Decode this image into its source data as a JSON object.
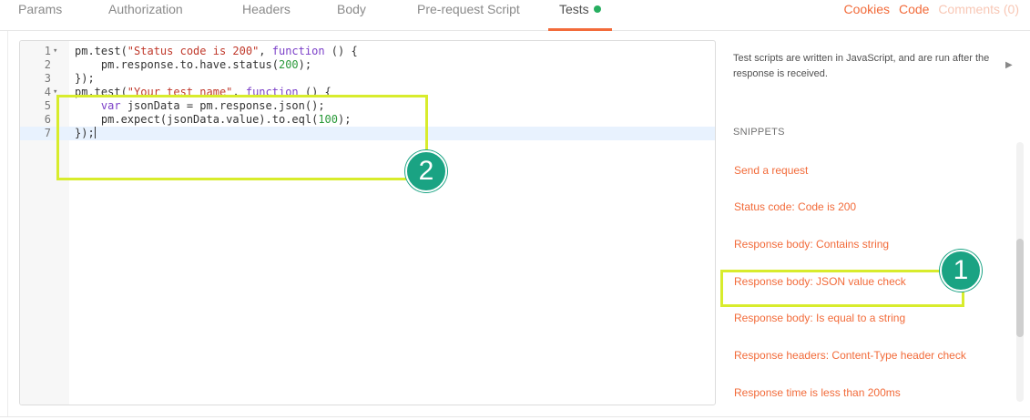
{
  "tabs": [
    "Params",
    "Authorization",
    "Headers",
    "Body",
    "Pre-request Script",
    "Tests"
  ],
  "active_tab": "Tests",
  "links": {
    "cookies": "Cookies",
    "code": "Code",
    "comments": "Comments (0)"
  },
  "editor": {
    "line_numbers": [
      "1",
      "2",
      "3",
      "4",
      "5",
      "6",
      "7"
    ],
    "lines": [
      [
        {
          "t": "pm.test(",
          "c": ""
        },
        {
          "t": "\"Status code is 200\"",
          "c": "s"
        },
        {
          "t": ", ",
          "c": ""
        },
        {
          "t": "function",
          "c": "k"
        },
        {
          "t": " () {",
          "c": ""
        }
      ],
      [
        {
          "t": "    pm.response.to.have.status(",
          "c": ""
        },
        {
          "t": "200",
          "c": "n"
        },
        {
          "t": ");",
          "c": ""
        }
      ],
      [
        {
          "t": "});",
          "c": ""
        }
      ],
      [
        {
          "t": "pm.test(",
          "c": ""
        },
        {
          "t": "\"Your test name\"",
          "c": "s"
        },
        {
          "t": ", ",
          "c": ""
        },
        {
          "t": "function",
          "c": "k"
        },
        {
          "t": " () {",
          "c": ""
        }
      ],
      [
        {
          "t": "    ",
          "c": ""
        },
        {
          "t": "var",
          "c": "k"
        },
        {
          "t": " jsonData = pm.response.json();",
          "c": ""
        }
      ],
      [
        {
          "t": "    pm.expect(jsonData.value).to.eql(",
          "c": ""
        },
        {
          "t": "100",
          "c": "n"
        },
        {
          "t": ");",
          "c": ""
        }
      ],
      [
        {
          "t": "});",
          "c": ""
        }
      ]
    ]
  },
  "help_text": "Test scripts are written in JavaScript, and are run after the response is received.",
  "snippets_title": "SNIPPETS",
  "snippets": [
    "Send a request",
    "Status code: Code is 200",
    "Response body: Contains string",
    "Response body: JSON value check",
    "Response body: Is equal to a string",
    "Response headers: Content-Type header check",
    "Response time is less than 200ms"
  ],
  "badges": {
    "snippet": "1",
    "code": "2"
  },
  "colors": {
    "accent": "#f26b3a",
    "highlight": "#d8ec2c",
    "badge": "#1aa383",
    "tests_dot": "#27ae60"
  }
}
